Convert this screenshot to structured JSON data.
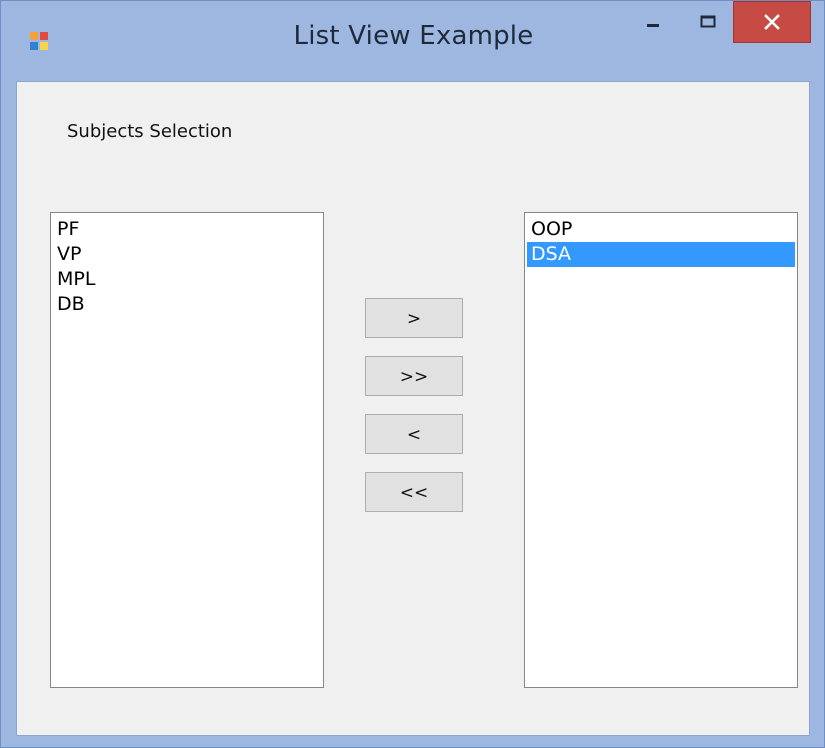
{
  "window": {
    "title": "List View Example",
    "controls": {
      "minimize": "minimize",
      "maximize": "maximize",
      "close": "close"
    }
  },
  "form": {
    "heading": "Subjects Selection",
    "left_list": {
      "items": [
        "PF",
        "VP",
        "MPL",
        "DB"
      ]
    },
    "right_list": {
      "items": [
        "OOP",
        "DSA"
      ],
      "selected_index": 1
    },
    "buttons": {
      "move_one": ">",
      "move_all": ">>",
      "back_one": "<",
      "back_all": "<<"
    }
  },
  "colors": {
    "selection": "#3399ff",
    "close_button": "#c74b45",
    "title_bar": "#9db7e0"
  }
}
